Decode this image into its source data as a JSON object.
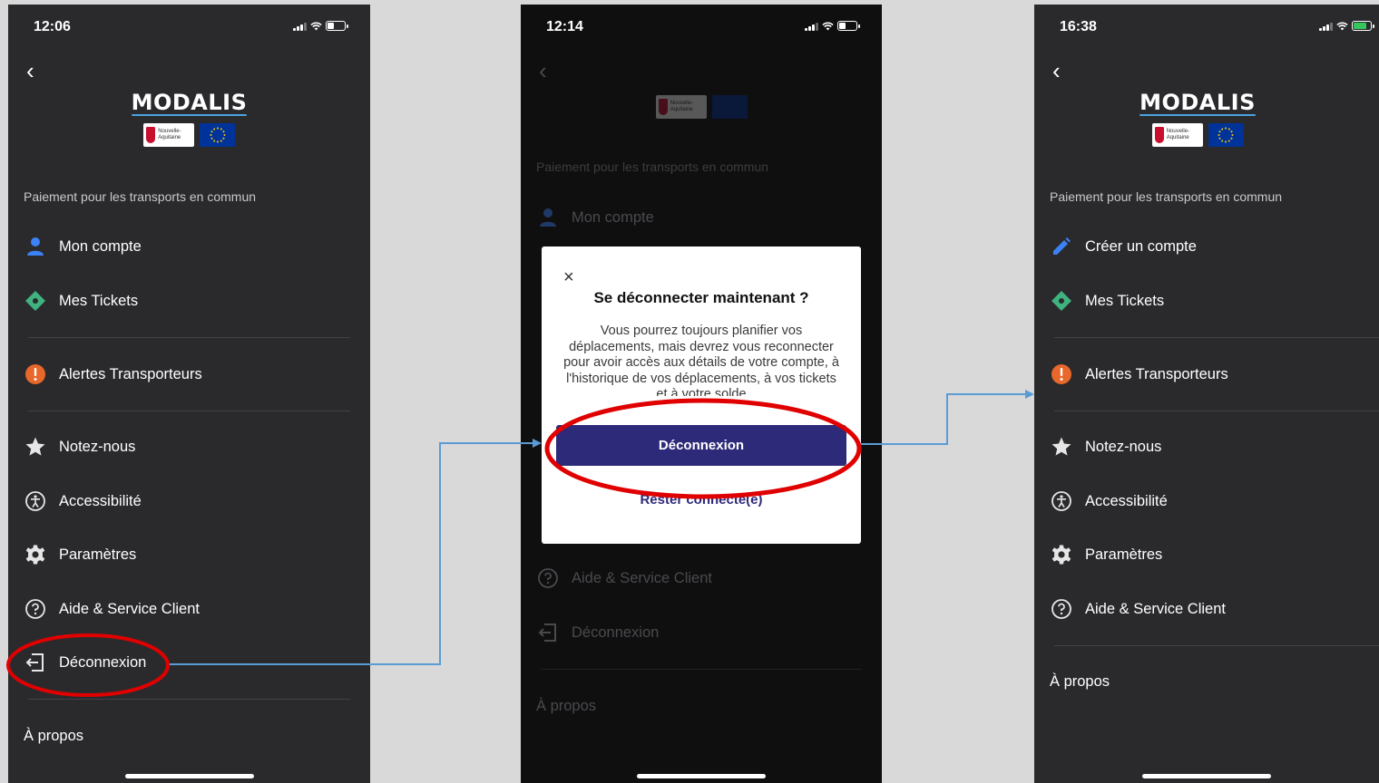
{
  "screens": [
    {
      "time": "12:06",
      "logo": "MODALIS",
      "region_text": "Nouvelle-Aquitaine",
      "subtitle": "Paiement pour les transports en commun",
      "menu": [
        "Mon compte",
        "Mes Tickets",
        "Alertes Transporteurs",
        "Notez-nous",
        "Accessibilité",
        "Paramètres",
        "Aide & Service Client",
        "Déconnexion"
      ],
      "about": "À propos"
    },
    {
      "time": "12:14",
      "region_text": "Nouvelle-Aquitaine",
      "subtitle": "Paiement pour les transports en commun",
      "menu": [
        "Mon compte",
        "Aide & Service Client",
        "Déconnexion"
      ],
      "about": "À propos",
      "dialog": {
        "close": "×",
        "title": "Se déconnecter maintenant ?",
        "body": "Vous pourrez toujours planifier vos déplacements, mais devrez vous reconnecter pour avoir accès aux détails de votre compte, à l'historique de vos déplacements, à vos tickets et à votre solde",
        "primary": "Déconnexion",
        "secondary": "Rester connecté(e)"
      }
    },
    {
      "time": "16:38",
      "logo": "MODALIS",
      "region_text": "Nouvelle-Aquitaine",
      "subtitle": "Paiement pour les transports en commun",
      "menu": [
        "Créer un compte",
        "Mes Tickets",
        "Alertes Transporteurs",
        "Notez-nous",
        "Accessibilité",
        "Paramètres",
        "Aide & Service Client"
      ],
      "about": "À propos"
    }
  ],
  "colors": {
    "panel_bg": "#2a2a2d",
    "dialog_primary": "#2e2a7a",
    "highlight_ellipse": "#e00000",
    "flow_arrow": "#5b9bd5",
    "account_icon": "#3b82f6",
    "tickets_icon": "#3fb27f",
    "alert_icon": "#e8672a"
  }
}
